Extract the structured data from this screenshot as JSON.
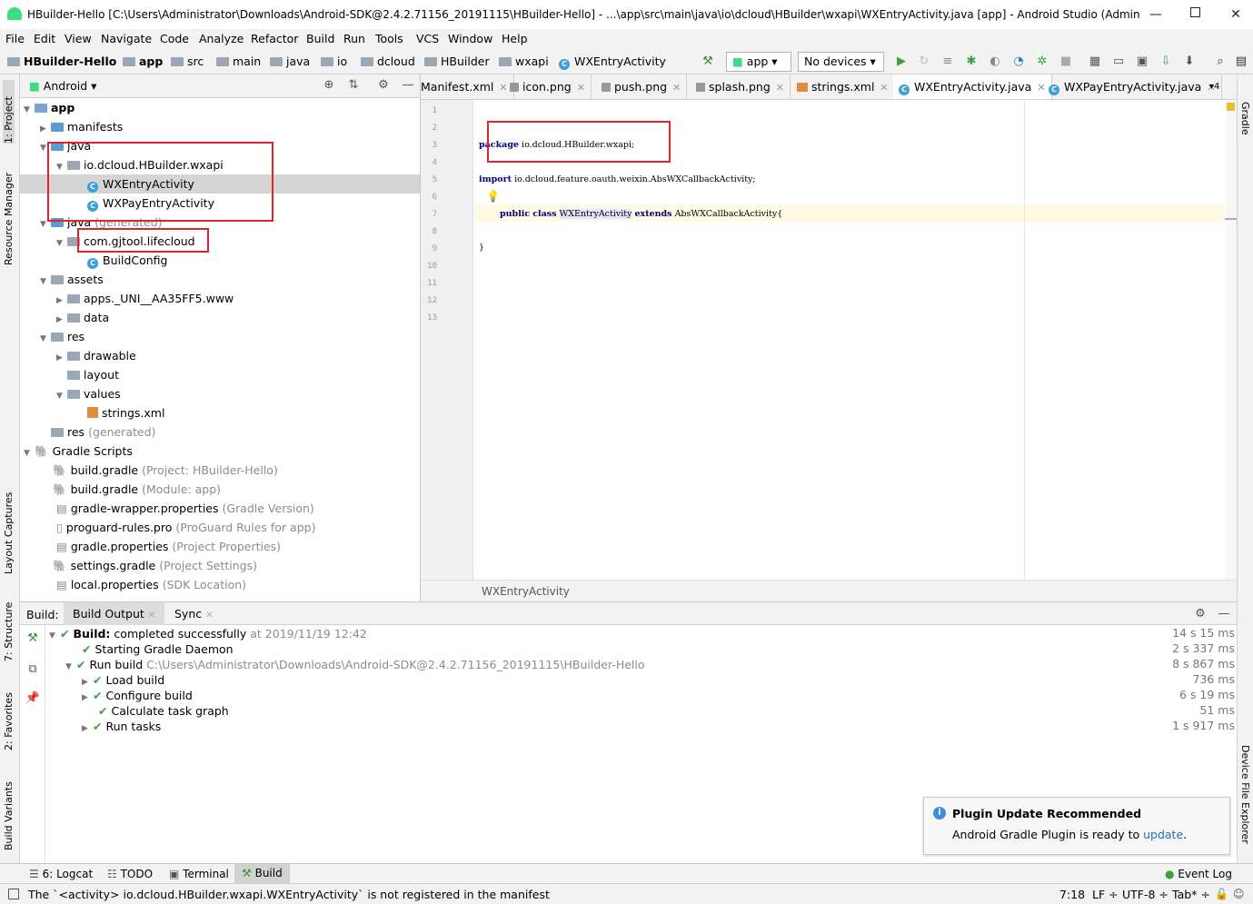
{
  "window": {
    "title": "HBuilder-Hello [C:\\Users\\Administrator\\Downloads\\Android-SDK@2.4.2.71156_20191115\\HBuilder-Hello] - ...\\app\\src\\main\\java\\io\\dcloud\\HBuilder\\wxapi\\WXEntryActivity.java [app] - Android Studio (Adminis..."
  },
  "menu": [
    "File",
    "Edit",
    "View",
    "Navigate",
    "Code",
    "Analyze",
    "Refactor",
    "Build",
    "Run",
    "Tools",
    "VCS",
    "Window",
    "Help"
  ],
  "breadcrumbs": [
    "HBuilder-Hello",
    "app",
    "src",
    "main",
    "java",
    "io",
    "dcloud",
    "HBuilder",
    "wxapi",
    "WXEntryActivity"
  ],
  "toolbar": {
    "run_config": "app",
    "device": "No devices"
  },
  "left_tool_tabs": [
    "1: Project",
    "Resource Manager",
    "Layout Captures",
    "7: Structure",
    "2: Favorites",
    "Build Variants"
  ],
  "right_tool_tabs": [
    "Gradle",
    "Device File Explorer"
  ],
  "project": {
    "view": "Android",
    "tree": [
      {
        "label": "app",
        "suffix": ""
      },
      {
        "label": "manifests",
        "suffix": ""
      },
      {
        "label": "java",
        "suffix": ""
      },
      {
        "label": "io.dcloud.HBuilder.wxapi",
        "suffix": ""
      },
      {
        "label": "WXEntryActivity",
        "suffix": ""
      },
      {
        "label": "WXPayEntryActivity",
        "suffix": ""
      },
      {
        "label": "java",
        "suffix": "(generated)"
      },
      {
        "label": "com.gjtool.lifecloud",
        "suffix": ""
      },
      {
        "label": "BuildConfig",
        "suffix": ""
      },
      {
        "label": "assets",
        "suffix": ""
      },
      {
        "label": "apps._UNI__AA35FF5.www",
        "suffix": ""
      },
      {
        "label": "data",
        "suffix": ""
      },
      {
        "label": "res",
        "suffix": ""
      },
      {
        "label": "drawable",
        "suffix": ""
      },
      {
        "label": "layout",
        "suffix": ""
      },
      {
        "label": "values",
        "suffix": ""
      },
      {
        "label": "strings.xml",
        "suffix": ""
      },
      {
        "label": "res",
        "suffix": "(generated)"
      },
      {
        "label": "Gradle Scripts",
        "suffix": ""
      },
      {
        "label": "build.gradle",
        "suffix": "(Project: HBuilder-Hello)"
      },
      {
        "label": "build.gradle",
        "suffix": "(Module: app)"
      },
      {
        "label": "gradle-wrapper.properties",
        "suffix": "(Gradle Version)"
      },
      {
        "label": "proguard-rules.pro",
        "suffix": "(ProGuard Rules for app)"
      },
      {
        "label": "gradle.properties",
        "suffix": "(Project Properties)"
      },
      {
        "label": "settings.gradle",
        "suffix": "(Project Settings)"
      },
      {
        "label": "local.properties",
        "suffix": "(SDK Location)"
      }
    ]
  },
  "editor_tabs": [
    "Manifest.xml",
    "icon.png",
    "push.png",
    "splash.png",
    "strings.xml",
    "WXEntryActivity.java",
    "WXPayEntryActivity.java",
    "4"
  ],
  "editor": {
    "line_numbers": [
      "1",
      "2",
      "3",
      "4",
      "5",
      "6",
      "7",
      "8",
      "9",
      "10",
      "11",
      "12",
      "13"
    ],
    "pkg_kw": "package",
    "pkg": "io.dcloud.HBuilder.wxapi;",
    "imp_kw": "import",
    "imp": "io.dcloud.feature.oauth.weixin.AbsWXCallbackActivity;",
    "cls_kw1": "public",
    "cls_kw2": "class",
    "cls_name": "WXEntryActivity",
    "cls_kw3": "extends",
    "cls_rest": "AbsWXCallbackActivity{",
    "close": "}",
    "breadcrumb": "WXEntryActivity"
  },
  "build": {
    "label": "Build:",
    "tabs": [
      "Build Output",
      "Sync"
    ],
    "rows": [
      {
        "bold": "Build:",
        "text": "completed successfully",
        "dim": "at 2019/11/19 12:42",
        "time": "14 s 15 ms"
      },
      {
        "bold": "",
        "text": "Starting Gradle Daemon",
        "dim": "",
        "time": "2 s 337 ms"
      },
      {
        "bold": "",
        "text": "Run build",
        "dim": "C:\\Users\\Administrator\\Downloads\\Android-SDK@2.4.2.71156_20191115\\HBuilder-Hello",
        "time": "8 s 867 ms"
      },
      {
        "bold": "",
        "text": "Load build",
        "dim": "",
        "time": "736 ms"
      },
      {
        "bold": "",
        "text": "Configure build",
        "dim": "",
        "time": "6 s 19 ms"
      },
      {
        "bold": "",
        "text": "Calculate task graph",
        "dim": "",
        "time": "51 ms"
      },
      {
        "bold": "",
        "text": "Run tasks",
        "dim": "",
        "time": "1 s 917 ms"
      }
    ]
  },
  "notification": {
    "title": "Plugin Update Recommended",
    "text": "Android Gradle Plugin is ready to",
    "link": "update",
    "end": "."
  },
  "bottom_tabs": [
    "6: Logcat",
    "TODO",
    "Terminal",
    "Build",
    "Event Log"
  ],
  "status": {
    "message": "The `<activity> io.dcloud.HBuilder.wxapi.WXEntryActivity` is not registered in the manifest",
    "pos": "7:18",
    "lf": "LF ÷",
    "enc": "UTF-8 ÷",
    "tab": "Tab* ÷"
  }
}
